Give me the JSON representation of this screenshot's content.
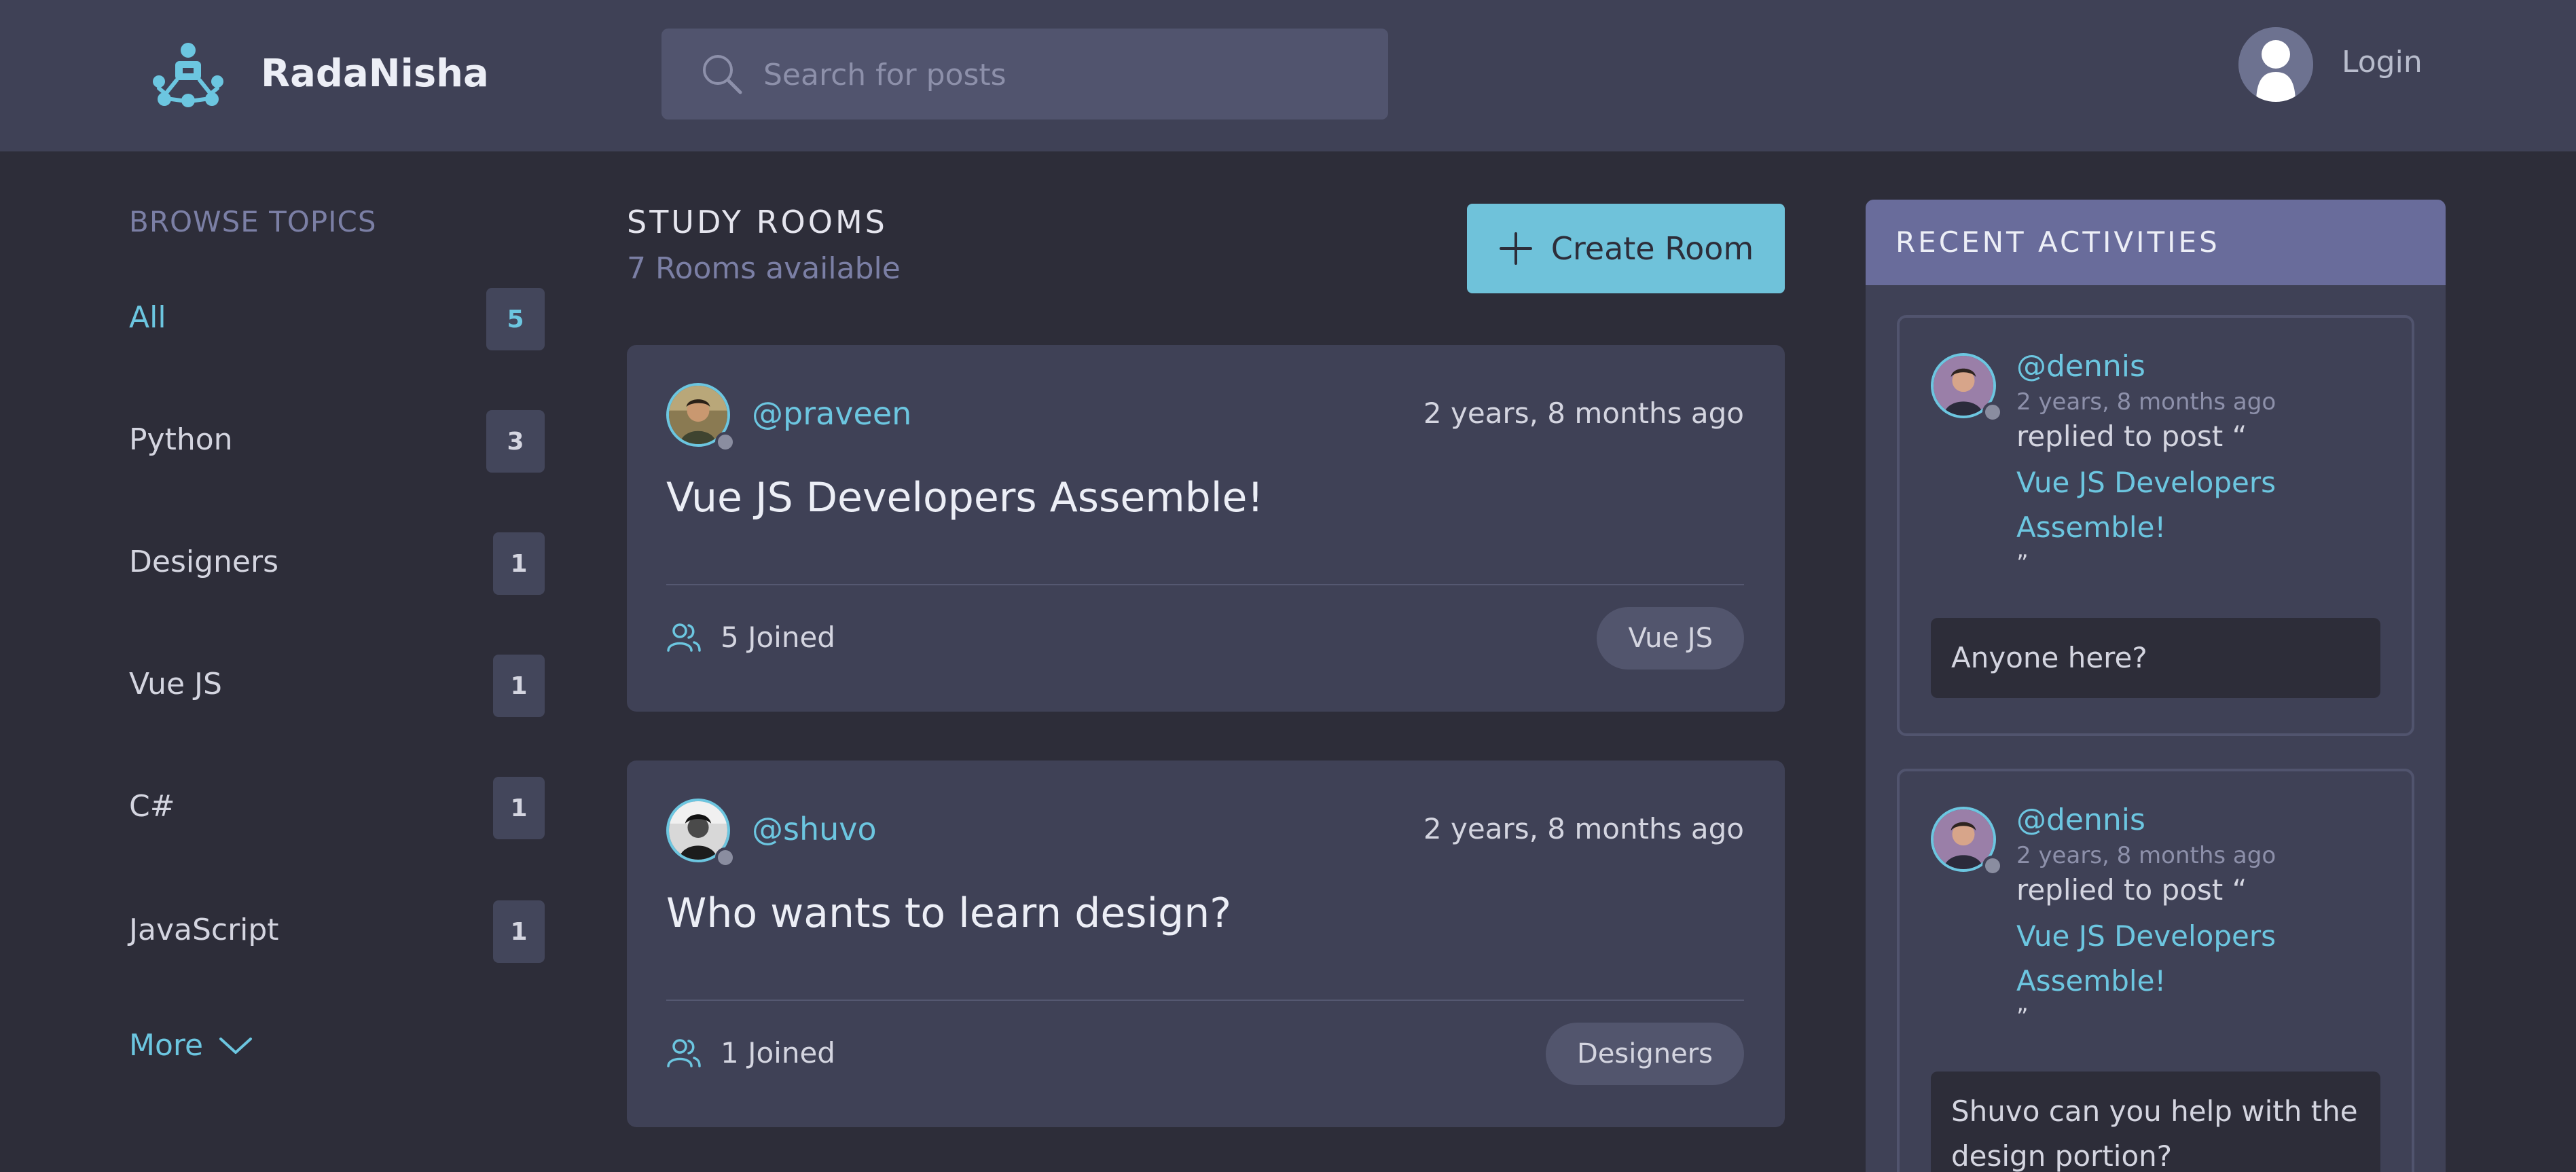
{
  "header": {
    "app_name": "RadaNisha",
    "search_placeholder": "Search for posts",
    "login_label": "Login"
  },
  "sidebar": {
    "title": "BROWSE TOPICS",
    "topics": [
      {
        "label": "All",
        "count": "5",
        "active": true
      },
      {
        "label": "Python",
        "count": "3"
      },
      {
        "label": "Designers",
        "count": "1"
      },
      {
        "label": "Vue JS",
        "count": "1"
      },
      {
        "label": "C#",
        "count": "1"
      },
      {
        "label": "JavaScript",
        "count": "1"
      }
    ],
    "more_label": "More"
  },
  "feed": {
    "title": "STUDY ROOMS",
    "subtitle": "7 Rooms available",
    "create_label": "Create Room",
    "rooms": [
      {
        "host": "@praveen",
        "time": "2 years, 8 months ago",
        "title": "Vue JS Developers Assemble!",
        "joined": "5 Joined",
        "tag": "Vue JS"
      },
      {
        "host": "@shuvo",
        "time": "2 years, 8 months ago",
        "title": "Who wants to learn design?",
        "joined": "1 Joined",
        "tag": "Designers"
      }
    ]
  },
  "activities": {
    "title": "RECENT ACTIVITIES",
    "items": [
      {
        "user": "@dennis",
        "time": "2 years, 8 months ago",
        "action": "replied to post “",
        "link": "Vue JS Developers Assemble!",
        "close": "”",
        "message": "Anyone here?"
      },
      {
        "user": "@dennis",
        "time": "2 years, 8 months ago",
        "action": "replied to post “",
        "link": "Vue JS Developers Assemble!",
        "close": "”",
        "message": "Shuvo can you help with the design portion?"
      }
    ]
  },
  "colors": {
    "background": "#2d2d39",
    "panel": "#3f4156",
    "accent": "#6cc6e0",
    "muted": "#7b7fa5",
    "activity_header": "#696c9b"
  },
  "icons": [
    "logo-icon",
    "search-icon",
    "user-avatar-icon",
    "chevron-down-icon",
    "plus-icon",
    "people-icon",
    "avatar-photo"
  ]
}
